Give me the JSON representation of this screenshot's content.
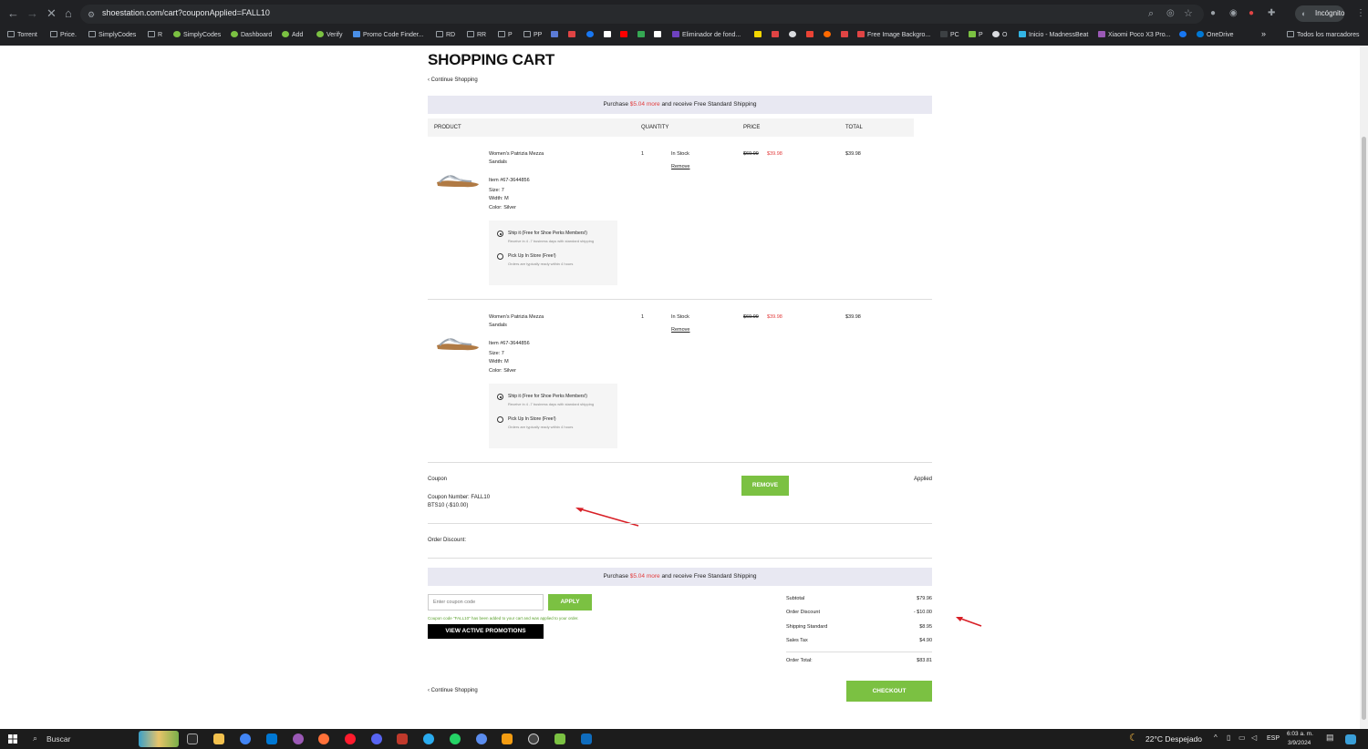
{
  "browser": {
    "url": "shoestation.com/cart?couponApplied=FALL10",
    "incognito_label": "Incógnito",
    "bookmarks": [
      "Torrent",
      "Price.",
      "SimplyCodes",
      "R",
      "SimplyCodes",
      "Dashboard",
      "Add",
      "Verify",
      "Promo Code Finder...",
      "RD",
      "RR",
      "P",
      "PP",
      "Eliminador de fond...",
      "Free Image Backgro...",
      "PC",
      "P",
      "O",
      "Inicio - MadnessBeat",
      "Xiaomi Poco X3 Pro...",
      "OneDrive"
    ],
    "bookmarks_folder": "Todos los marcadores"
  },
  "cart": {
    "title": "SHOPPING CART",
    "continue_shopping": "‹ Continue Shopping",
    "promo_band": {
      "prefix": "Purchase ",
      "amount": "$5.04 more",
      "suffix": " and receive Free Standard Shipping"
    },
    "columns": [
      "PRODUCT",
      "QUANTITY",
      "PRICE",
      "TOTAL"
    ],
    "items": [
      {
        "name_line1": "Women's Patrizia Mezza",
        "name_line2": "Sandals",
        "item_no": "Item #67-3644856",
        "size": "Size: 7",
        "width": "Width: M",
        "color": "Color: Silver",
        "qty": "1",
        "stock": "In Stock",
        "remove": "Remove",
        "orig_price": "$69.99",
        "sale_price": "$39.98",
        "total": "$39.98",
        "ship_label": "Ship it (Free for Shoe Perks Members!)",
        "ship_sub": "Receive in 4 -7 business days with standard shipping",
        "pickup_label": "Pick Up In Store (Free!)",
        "pickup_sub": "Orders are typically ready within 4 hours"
      },
      {
        "name_line1": "Women's Patrizia Mezza",
        "name_line2": "Sandals",
        "item_no": "Item #67-3644856",
        "size": "Size: 7",
        "width": "Width: M",
        "color": "Color: Silver",
        "qty": "1",
        "stock": "In Stock",
        "remove": "Remove",
        "orig_price": "$69.99",
        "sale_price": "$39.98",
        "total": "$39.98",
        "ship_label": "Ship it (Free for Shoe Perks Members!)",
        "ship_sub": "Receive in 4 -7 business days with standard shipping",
        "pickup_label": "Pick Up In Store (Free!)",
        "pickup_sub": "Orders are typically ready within 4 hours"
      }
    ],
    "coupon": {
      "label": "Coupon",
      "remove_btn": "REMOVE",
      "status": "Applied",
      "number": "Coupon Number: FALL10",
      "detail": "BTS10 (-$10.00)"
    },
    "order_discount_label": "Order Discount:",
    "coupon_input_placeholder": "Enter coupon code",
    "apply_btn": "APPLY",
    "coupon_msg": "Coupon code \"FALL10\" has been added to your cart and was applied to your order.",
    "view_promos_btn": "VIEW ACTIVE PROMOTIONS",
    "summary": {
      "subtotal_label": "Subtotal",
      "subtotal": "$79.96",
      "discount_label": "Order Discount",
      "discount": "- $10.00",
      "shipping_label": "Shipping Standard",
      "shipping": "$8.95",
      "tax_label": "Sales Tax",
      "tax": "$4.90",
      "total_label": "Order Total:",
      "total": "$83.81"
    },
    "checkout_btn": "CHECKOUT"
  },
  "taskbar": {
    "search": "Buscar",
    "weather": "22°C  Despejado",
    "lang": "ESP",
    "time": "6:03 a. m.",
    "date": "3/9/2024"
  },
  "colors": {
    "accent_green": "#7bc142",
    "sale_red": "#e23b3b",
    "band": "#e8e8f2"
  }
}
